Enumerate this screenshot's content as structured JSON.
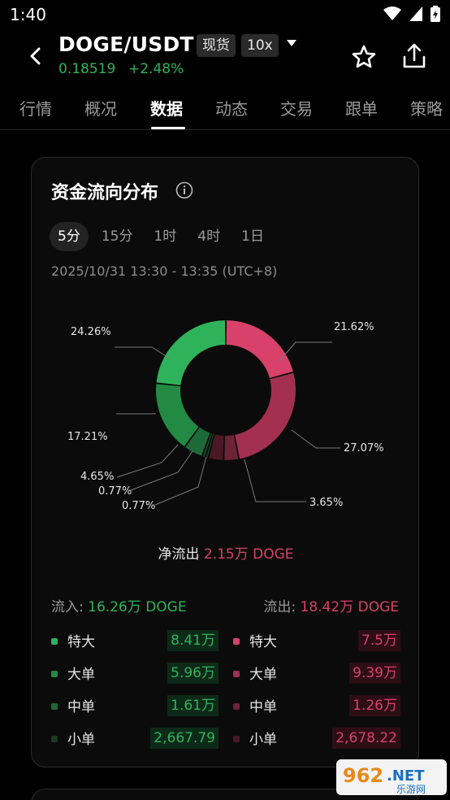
{
  "status_bar": {
    "time": "1:40"
  },
  "header": {
    "pair": "DOGE/USDT",
    "tag_spot": "现货",
    "tag_leverage": "10x",
    "price": "0.18519",
    "change": "+2.48%"
  },
  "tabs": [
    "行情",
    "概况",
    "数据",
    "动态",
    "交易",
    "跟单",
    "策略"
  ],
  "active_tab": "数据",
  "card": {
    "title": "资金流向分布",
    "periods": [
      "5分",
      "15分",
      "1时",
      "4时",
      "1日"
    ],
    "active_period": "5分",
    "time_range": "2025/10/31 13:30 - 13:35 (UTC+8)",
    "net_flow_label": "净流出",
    "net_flow_value": "2.15万 DOGE",
    "inflow_label": "流入:",
    "inflow_value": "16.26万 DOGE",
    "outflow_label": "流出:",
    "outflow_value": "18.42万 DOGE",
    "inflow_rows": [
      {
        "label": "特大",
        "value": "8.41万"
      },
      {
        "label": "大单",
        "value": "5.96万"
      },
      {
        "label": "中单",
        "value": "1.61万"
      },
      {
        "label": "小单",
        "value": "2,667.79"
      }
    ],
    "outflow_rows": [
      {
        "label": "特大",
        "value": "7.5万"
      },
      {
        "label": "大单",
        "value": "9.39万"
      },
      {
        "label": "中单",
        "value": "1.26万"
      },
      {
        "label": "小单",
        "value": "2,678.22"
      }
    ]
  },
  "donut": {
    "segments": [
      {
        "pct": 21.62,
        "label": "21.62%",
        "color": "#d8416a"
      },
      {
        "pct": 27.07,
        "label": "27.07%",
        "color": "#a3304f"
      },
      {
        "pct": 3.65,
        "label": "3.65%",
        "color": "#6e2236"
      },
      {
        "pct": 3.65,
        "label": "",
        "color": "#4a1826"
      },
      {
        "pct": 0.77,
        "label": "0.77%",
        "color": "#1b3a24"
      },
      {
        "pct": 0.77,
        "label": "0.77%",
        "color": "#1f4a2c"
      },
      {
        "pct": 4.65,
        "label": "4.65%",
        "color": "#1d6a38"
      },
      {
        "pct": 17.21,
        "label": "17.21%",
        "color": "#228a43"
      },
      {
        "pct": 24.26,
        "label": "24.26%",
        "color": "#2fb35a"
      }
    ]
  },
  "colors": {
    "inflow": "#2fb35a",
    "outflow": "#d8416a"
  },
  "watermark": {
    "top": "962",
    "suffix": ".NET",
    "sub": "乐游网"
  }
}
